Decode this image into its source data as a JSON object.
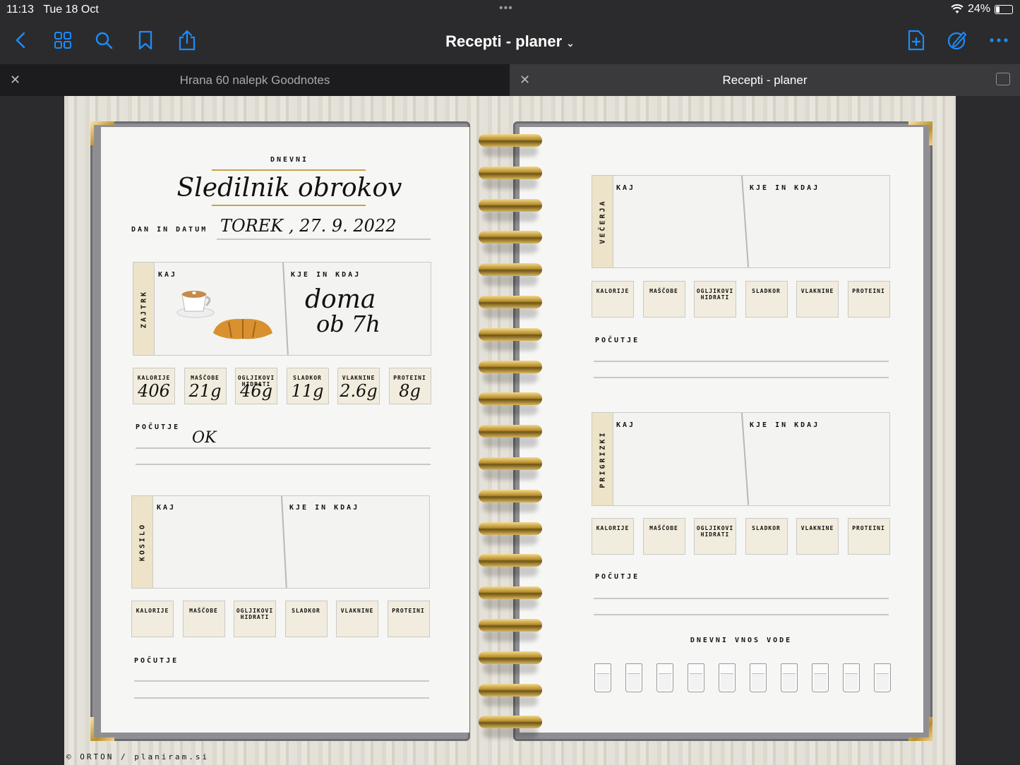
{
  "status_bar": {
    "time": "11:13",
    "date": "Tue 18 Oct",
    "battery": "24%"
  },
  "toolbar": {
    "title": "Recepti - planer"
  },
  "tabs": [
    {
      "label": "Hrana 60 nalepk Goodnotes",
      "active": false
    },
    {
      "label": "Recepti - planer",
      "active": true
    }
  ],
  "left_page": {
    "kicker": "DNEVNI",
    "title": "Sledilnik obrokov",
    "date_label": "DAN IN DATUM",
    "date_value": "TOREK , 27. 9. 2022",
    "breakfast": {
      "tag": "ZAJTRK",
      "kaj_label": "KAJ",
      "kje_label": "KJE IN KDAJ",
      "kje_value_line1": "doma",
      "kje_value_line2": "ob 7h",
      "nutrients": [
        {
          "label": "KALORIJE",
          "value": "406"
        },
        {
          "label": "MAŠČOBE",
          "value": "21g"
        },
        {
          "label": "OGLJIKOVI HIDRATI",
          "value": "46g"
        },
        {
          "label": "SLADKOR",
          "value": "11g"
        },
        {
          "label": "VLAKNINE",
          "value": "2.6g"
        },
        {
          "label": "PROTEINI",
          "value": "8g"
        }
      ],
      "feeling_label": "POČUTJE",
      "feeling_value": "OK"
    },
    "lunch": {
      "tag": "KOSILO",
      "kaj_label": "KAJ",
      "kje_label": "KJE IN KDAJ",
      "nutrients": [
        "KALORIJE",
        "MAŠČOBE",
        "OGLJIKOVI HIDRATI",
        "SLADKOR",
        "VLAKNINE",
        "PROTEINI"
      ],
      "feeling_label": "POČUTJE"
    }
  },
  "right_page": {
    "dinner": {
      "tag": "VEČERJA",
      "kaj_label": "KAJ",
      "kje_label": "KJE IN KDAJ",
      "nutrients": [
        "KALORIJE",
        "MAŠČOBE",
        "OGLJIKOVI HIDRATI",
        "SLADKOR",
        "VLAKNINE",
        "PROTEINI"
      ],
      "feeling_label": "POČUTJE"
    },
    "snacks": {
      "tag": "PRIGRIZKI",
      "kaj_label": "KAJ",
      "kje_label": "KJE IN KDAJ",
      "nutrients": [
        "KALORIJE",
        "MAŠČOBE",
        "OGLJIKOVI HIDRATI",
        "SLADKOR",
        "VLAKNINE",
        "PROTEINI"
      ],
      "feeling_label": "POČUTJE"
    },
    "water_label": "DNEVNI VNOS VODE",
    "water_glasses": 10
  },
  "footer_credit": "ORTON / planiram.si",
  "colors": {
    "accent": "#1a8cff",
    "gold": "#c9a24a",
    "tag_beige": "#ede3c8"
  },
  "icons": [
    "back-chevron-icon",
    "grid-icon",
    "search-icon",
    "bookmark-icon",
    "share-icon",
    "add-page-icon",
    "pencil-icon",
    "more-icon",
    "coffee-cup-sticker-icon",
    "croissant-sticker-icon",
    "water-glass-icon"
  ]
}
